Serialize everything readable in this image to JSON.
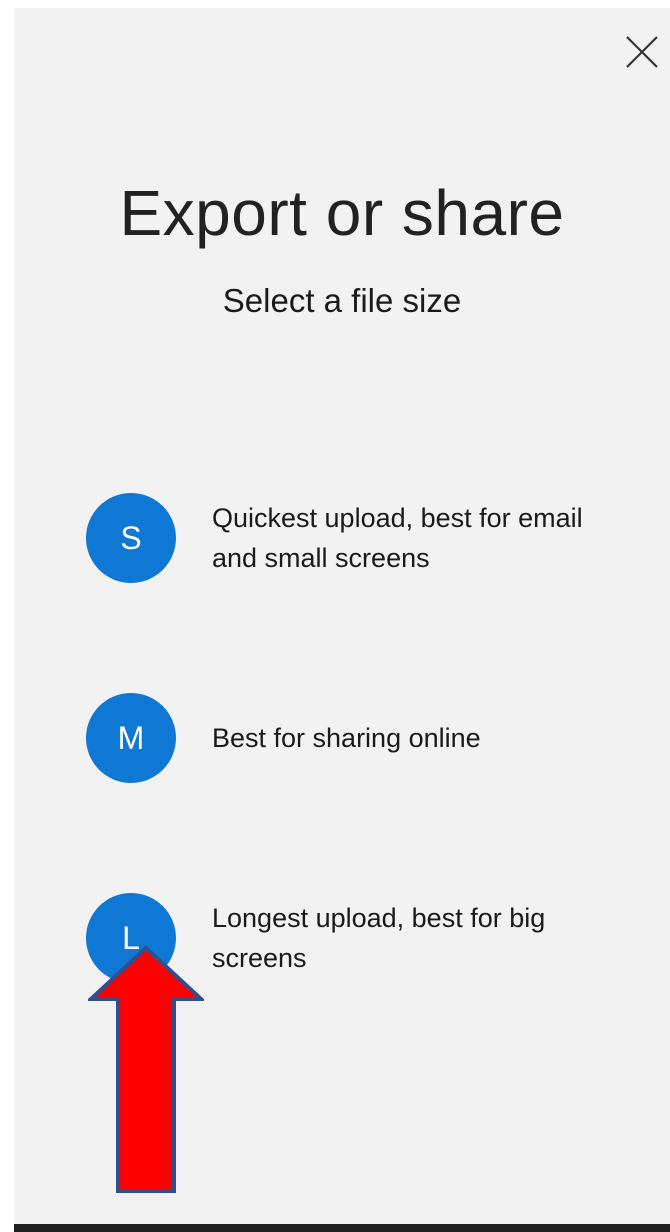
{
  "dialog": {
    "title": "Export or share",
    "subtitle": "Select a file size",
    "close_icon": "close-icon"
  },
  "options": [
    {
      "letter": "S",
      "description": "Quickest upload, best for email and small screens"
    },
    {
      "letter": "M",
      "description": "Best for sharing online"
    },
    {
      "letter": "L",
      "description": "Longest upload, best for big screens"
    }
  ],
  "colors": {
    "panel_background": "#f2f2f2",
    "circle": "#0f78d4",
    "arrow_fill": "#ff0000",
    "arrow_stroke": "#2f4f8f"
  },
  "annotation": {
    "icon": "red-arrow-icon",
    "points_to": "L"
  }
}
